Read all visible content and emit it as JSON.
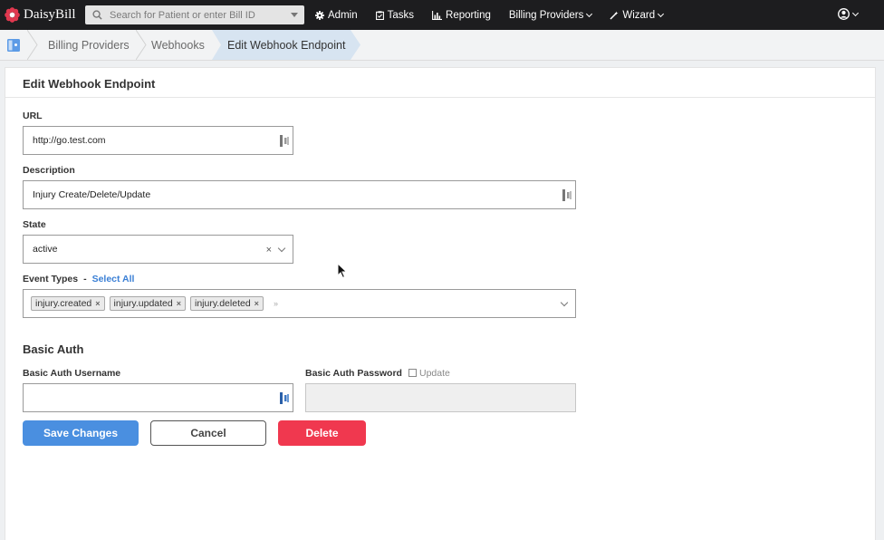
{
  "app": {
    "name": "DaisyBill",
    "brand_color": "#e0384f"
  },
  "search": {
    "placeholder": "Search for Patient or enter Bill ID"
  },
  "nav": {
    "items": [
      {
        "label": "Admin",
        "icon": "gear-icon"
      },
      {
        "label": "Tasks",
        "icon": "clipboard-icon"
      },
      {
        "label": "Reporting",
        "icon": "bar-chart-icon"
      },
      {
        "label": "Billing Providers",
        "icon": ""
      },
      {
        "label": "Wizard",
        "icon": "wand-icon"
      }
    ]
  },
  "breadcrumb": {
    "items": [
      {
        "label": "Billing Providers"
      },
      {
        "label": "Webhooks"
      },
      {
        "label": "Edit Webhook Endpoint"
      }
    ]
  },
  "form": {
    "title": "Edit Webhook Endpoint",
    "url_label": "URL",
    "url_value": "http://go.test.com",
    "description_label": "Description",
    "description_value": "Injury Create/Delete/Update",
    "state_label": "State",
    "state_value": "active",
    "state_clear": "×",
    "event_types_label": "Event Types",
    "event_types_separator": "-",
    "select_all": "Select All",
    "event_types": [
      "injury.created",
      "injury.updated",
      "injury.deleted"
    ],
    "tag_remove": "×",
    "tag_more": "»",
    "basic_auth_title": "Basic Auth",
    "username_label": "Basic Auth Username",
    "username_value": "",
    "password_label": "Basic Auth Password",
    "password_update_label": "Update",
    "save_label": "Save Changes",
    "cancel_label": "Cancel",
    "delete_label": "Delete"
  },
  "colors": {
    "primary": "#4a8fe0",
    "danger": "#f0384f",
    "breadcrumb_active": "#d7e4f1"
  }
}
